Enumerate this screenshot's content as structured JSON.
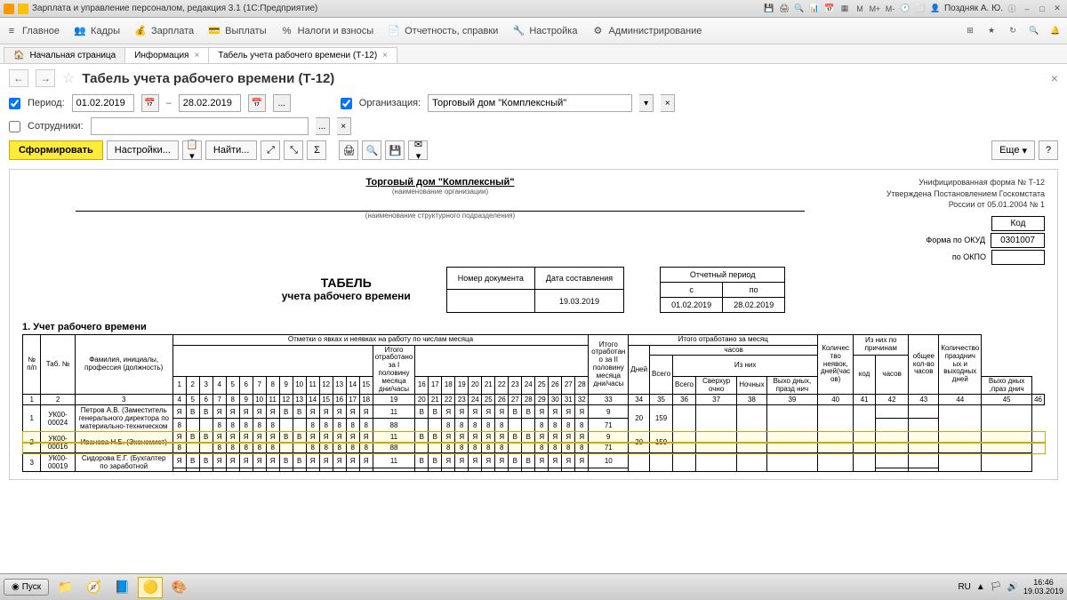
{
  "titlebar": {
    "app": "Зарплата и управление персоналом, редакция 3.1  (1С:Предприятие)",
    "user": "Поздняк А. Ю."
  },
  "menu": {
    "main": "Главное",
    "staff": "Кадры",
    "salary": "Зарплата",
    "payments": "Выплаты",
    "taxes": "Налоги и взносы",
    "reports": "Отчетность, справки",
    "settings": "Настройка",
    "admin": "Администрирование"
  },
  "tabs": {
    "home": "Начальная страница",
    "info": "Информация",
    "t12": "Табель учета рабочего времени (Т-12)"
  },
  "page": {
    "title": "Табель учета рабочего времени (Т-12)"
  },
  "filters": {
    "period_lbl": "Период:",
    "date_from": "01.02.2019",
    "date_to": "28.02.2019",
    "org_lbl": "Организация:",
    "org": "Торговый дом \"Комплексный\"",
    "emp_lbl": "Сотрудники:"
  },
  "toolbar": {
    "generate": "Сформировать",
    "settings": "Настройки...",
    "find": "Найти...",
    "more": "Еще"
  },
  "report": {
    "form_id": "Унифицированная форма № Т-12",
    "approved": "Утверждена Постановлением Госкомстата",
    "approved2": "России от 05.01.2004 № 1",
    "code_lbl": "Код",
    "okud_lbl": "Форма по ОКУД",
    "okud": "0301007",
    "okpo_lbl": "по ОКПО",
    "org": "Торговый дом \"Комплексный\"",
    "org_sub": "(наименование организации)",
    "dept_sub": "(наименование структурного подразделения)",
    "title1": "ТАБЕЛЬ",
    "title2": "учета рабочего времени",
    "doc_num_lbl": "Номер документа",
    "doc_date_lbl": "Дата составления",
    "doc_date": "19.03.2019",
    "period_lbl": "Отчетный период",
    "from_lbl": "с",
    "to_lbl": "по",
    "from": "01.02.2019",
    "to": "28.02.2019",
    "sec1": "1. Учет рабочего времени",
    "hdr": {
      "num": "№ п/п",
      "tab": "Таб. №",
      "fio": "Фамилия, инициалы, профессия (должность)",
      "marks": "Отметки о явках и неявках на работу по числам месяца",
      "half1": "Итого отработано за I половину месяца дни/часы",
      "half2": "Итого отработан о за II половину месяца дни/часы",
      "total": "Итого отработано за месяц",
      "days": "Дней",
      "hours": "часов",
      "hours_all": "Всего",
      "from_them": "Из них",
      "overtime": "Сверхур очно",
      "night": "Ночных",
      "weekend": "Выхо дных, празд нич",
      "weekend2": "Выхо дных ,праз днич",
      "absent": "Количес тво неявок, дней(час ов)",
      "code": "код",
      "reasons": "Из них по причинам",
      "total_hours": "общее кол-во часов",
      "holidays": "Количество празднич ых и выходных дней"
    },
    "rows": [
      {
        "n": "1",
        "tab": "УК00-00024",
        "name": "Петров А.В. (Заместитель генерального директора по материально-техническом",
        "marks1": [
          "Я",
          "В",
          "В",
          "Я",
          "Я",
          "Я",
          "Я",
          "Я",
          "В",
          "В",
          "Я",
          "Я",
          "Я",
          "Я",
          "Я"
        ],
        "half1": "11",
        "marks2": [
          "В",
          "В",
          "Я",
          "Я",
          "Я",
          "Я",
          "Я",
          "В",
          "В",
          "Я",
          "Я",
          "Я",
          "Я"
        ],
        "half2": "9",
        "hours1": [
          "8",
          "",
          "",
          "8",
          "8",
          "8",
          "8",
          "8",
          "",
          "",
          "8",
          "8",
          "8",
          "8",
          "8"
        ],
        "h1": "88",
        "hours2": [
          "",
          "",
          "8",
          "8",
          "8",
          "8",
          "8",
          "",
          "",
          "8",
          "8",
          "8",
          "8"
        ],
        "h2": "71",
        "days": "20",
        "thours": "159"
      },
      {
        "n": "2",
        "tab": "УК00-00016",
        "name": "Иванова Н.Б. (Экономист)",
        "marks1": [
          "Я",
          "В",
          "В",
          "Я",
          "Я",
          "Я",
          "Я",
          "Я",
          "В",
          "В",
          "Я",
          "Я",
          "Я",
          "Я",
          "Я"
        ],
        "half1": "11",
        "marks2": [
          "В",
          "В",
          "Я",
          "Я",
          "Я",
          "Я",
          "Я",
          "В",
          "В",
          "Я",
          "Я",
          "Я",
          "Я"
        ],
        "half2": "9",
        "hours1": [
          "8",
          "",
          "",
          "8",
          "8",
          "8",
          "8",
          "8",
          "",
          "",
          "8",
          "8",
          "8",
          "8",
          "8"
        ],
        "h1": "88",
        "hours2": [
          "",
          "",
          "8",
          "8",
          "8",
          "8",
          "8",
          "",
          "",
          "8",
          "8",
          "8",
          "8"
        ],
        "h2": "71",
        "days": "20",
        "thours": "159"
      },
      {
        "n": "3",
        "tab": "УК00-00019",
        "name": "Сидорова Е.Г. (Бухгалтер по заработной",
        "marks1": [
          "Я",
          "В",
          "В",
          "Я",
          "Я",
          "Я",
          "Я",
          "Я",
          "В",
          "В",
          "Я",
          "Я",
          "Я",
          "Я",
          "Я"
        ],
        "half1": "11",
        "marks2": [
          "В",
          "В",
          "Я",
          "Я",
          "Я",
          "Я",
          "Я",
          "В",
          "В",
          "Я",
          "Я",
          "Я",
          "Я"
        ],
        "half2": "10",
        "hours1": [],
        "h1": "",
        "hours2": [],
        "h2": "",
        "days": "",
        "thours": ""
      }
    ]
  },
  "taskbar": {
    "start": "Пуск",
    "lang": "RU",
    "time": "16:46",
    "date": "19.03.2019"
  }
}
